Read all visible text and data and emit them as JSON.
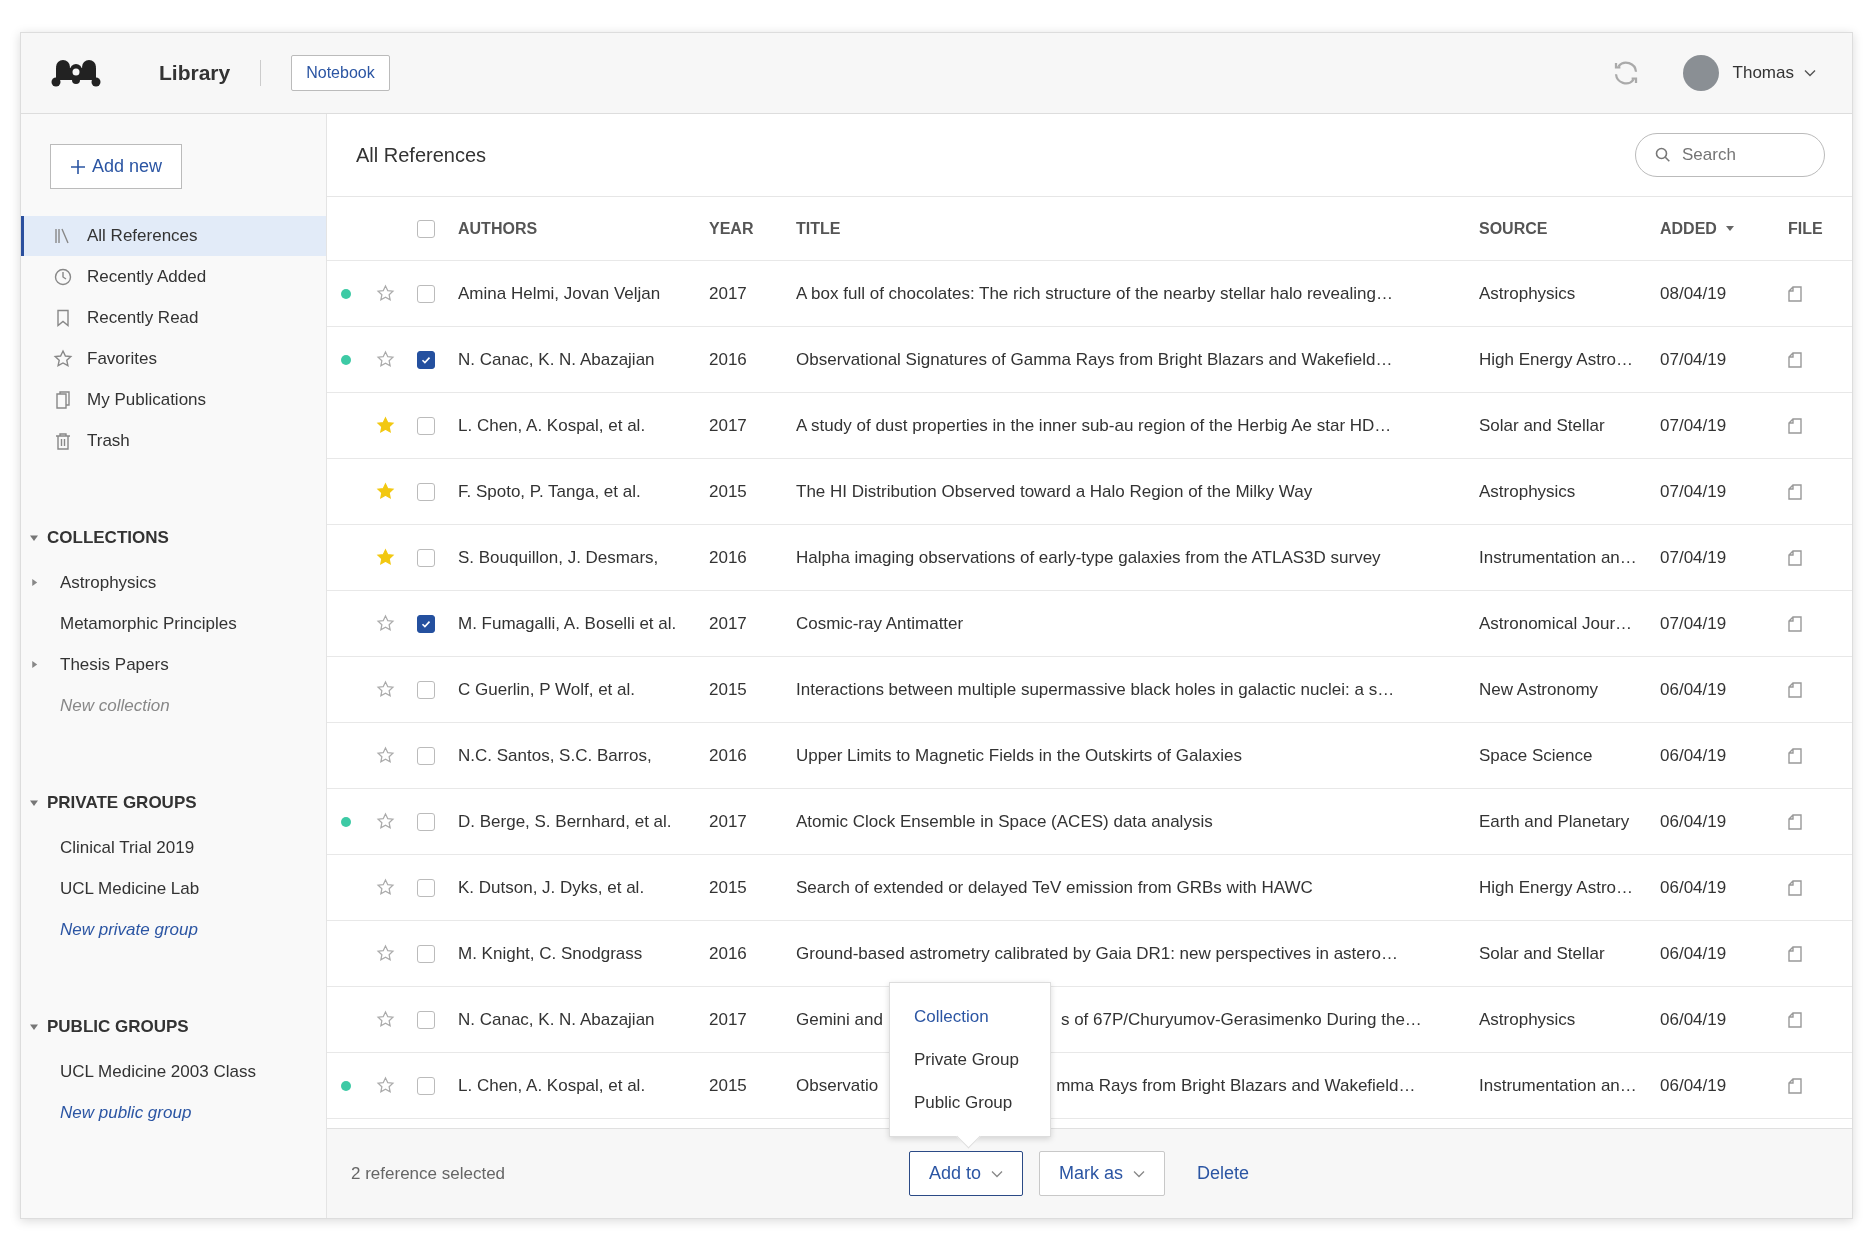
{
  "app": {
    "section": "Library",
    "notebook_button": "Notebook",
    "user": "Thomas"
  },
  "sidebar": {
    "add_button": "Add new",
    "nav": [
      {
        "label": "All References",
        "selected": true
      },
      {
        "label": "Recently Added",
        "selected": false
      },
      {
        "label": "Recently Read",
        "selected": false
      },
      {
        "label": "Favorites",
        "selected": false
      },
      {
        "label": "My Publications",
        "selected": false
      },
      {
        "label": "Trash",
        "selected": false
      }
    ],
    "sections": [
      {
        "title": "COLLECTIONS",
        "expanded": true,
        "items": [
          {
            "label": "Astrophysics",
            "kind": "folder",
            "expandable": true
          },
          {
            "label": "Metamorphic Principles",
            "kind": "folder",
            "expandable": false
          },
          {
            "label": "Thesis Papers",
            "kind": "folder",
            "expandable": true
          },
          {
            "label": "New collection",
            "kind": "placeholder",
            "expandable": false
          }
        ]
      },
      {
        "title": "PRIVATE GROUPS",
        "expanded": true,
        "items": [
          {
            "label": "Clinical Trial 2019",
            "kind": "folder",
            "expandable": false
          },
          {
            "label": "UCL Medicine Lab",
            "kind": "folder",
            "expandable": false
          },
          {
            "label": "New private group",
            "kind": "link",
            "expandable": false
          }
        ]
      },
      {
        "title": "PUBLIC GROUPS",
        "expanded": true,
        "items": [
          {
            "label": "UCL Medicine 2003 Class",
            "kind": "folder",
            "expandable": false
          },
          {
            "label": "New public group",
            "kind": "link",
            "expandable": false
          }
        ]
      }
    ]
  },
  "main": {
    "title": "All References",
    "search": {
      "placeholder": "Search"
    },
    "table": {
      "select_all_checked": false,
      "columns": [
        {
          "label": "AUTHORS",
          "sorted": false
        },
        {
          "label": "YEAR",
          "sorted": false
        },
        {
          "label": "TITLE",
          "sorted": false
        },
        {
          "label": "SOURCE",
          "sorted": false
        },
        {
          "label": "ADDED",
          "sorted": true
        },
        {
          "label": "FILE",
          "sorted": false
        }
      ],
      "rows": [
        {
          "unread": true,
          "starred": false,
          "checked": false,
          "authors": "Amina Helmi, Jovan Veljan",
          "year": "2017",
          "title": [
            "A box full of chocolates: The rich structure of the nearby stellar halo revealing…"
          ],
          "source": "Astrophysics",
          "added": "08/04/19"
        },
        {
          "unread": true,
          "starred": false,
          "checked": true,
          "authors": "N. Canac, K. N. Abazajian",
          "year": "2016",
          "title": [
            "Observational Signatures of Gamma Rays from Bright Blazars and Wakefield…"
          ],
          "source": "High Energy Astro…",
          "added": "07/04/19"
        },
        {
          "unread": false,
          "starred": true,
          "checked": false,
          "authors": "L. Chen, A. Kospal, et al.",
          "year": "2017",
          "title": [
            "A study of dust properties in the inner sub-au region of the Herbig Ae star HD…"
          ],
          "source": "Solar and Stellar",
          "added": "07/04/19"
        },
        {
          "unread": false,
          "starred": true,
          "checked": false,
          "authors": "F. Spoto, P. Tanga, et al.",
          "year": "2015",
          "title": [
            "The HI Distribution Observed toward a Halo Region of the Milky Way"
          ],
          "source": "Astrophysics",
          "added": "07/04/19"
        },
        {
          "unread": false,
          "starred": true,
          "checked": false,
          "authors": "S. Bouquillon, J. Desmars,",
          "year": "2016",
          "title": [
            "Halpha imaging observations of early-type galaxies from the ATLAS3D survey"
          ],
          "source": "Instrumentation an…",
          "added": "07/04/19"
        },
        {
          "unread": false,
          "starred": false,
          "checked": true,
          "authors": "M. Fumagalli, A. Boselli et al.",
          "year": "2017",
          "title": [
            "Cosmic-ray Antimatter"
          ],
          "source": "Astronomical Jour…",
          "added": "07/04/19"
        },
        {
          "unread": false,
          "starred": false,
          "checked": false,
          "authors": "C Guerlin, P Wolf, et al.",
          "year": "2015",
          "title": [
            "Interactions between multiple supermassive black holes in galactic nuclei: a s…"
          ],
          "source": "New Astronomy",
          "added": "06/04/19"
        },
        {
          "unread": false,
          "starred": false,
          "checked": false,
          "authors": "N.C. Santos, S.C. Barros,",
          "year": "2016",
          "title": [
            "Upper Limits to Magnetic Fields in the Outskirts of Galaxies"
          ],
          "source": "Space Science",
          "added": "06/04/19"
        },
        {
          "unread": true,
          "starred": false,
          "checked": false,
          "authors": "D. Berge, S. Bernhard, et al.",
          "year": "2017",
          "title": [
            "Atomic Clock Ensemble in Space (ACES) data analysis"
          ],
          "source": "Earth and Planetary",
          "added": "06/04/19"
        },
        {
          "unread": false,
          "starred": false,
          "checked": false,
          "authors": "K. Dutson, J. Dyks, et al.",
          "year": "2015",
          "title": [
            "Search of extended or delayed TeV emission from GRBs with HAWC"
          ],
          "source": "High Energy Astro…",
          "added": "06/04/19"
        },
        {
          "unread": false,
          "starred": false,
          "checked": false,
          "authors": "M. Knight, C. Snodgrass",
          "year": "2016",
          "title": [
            "Ground-based astrometry calibrated by Gaia DR1: new perspectives in astero…"
          ],
          "source": "Solar and Stellar",
          "added": "06/04/19"
        },
        {
          "unread": false,
          "starred": false,
          "checked": false,
          "authors": "N. Canac, K. N. Abazajian",
          "year": "2017",
          "title": [
            "Gemini and",
            "s of 67P/Churyumov-Gerasimenko During the…"
          ],
          "source": "Astrophysics",
          "added": "06/04/19"
        },
        {
          "unread": true,
          "starred": false,
          "checked": false,
          "authors": "L. Chen, A. Kospal, et al.",
          "year": "2015",
          "title": [
            "Observatio",
            "mma Rays from Bright Blazars and Wakefield…"
          ],
          "source": "Instrumentation an…",
          "added": "06/04/19"
        }
      ]
    }
  },
  "footer": {
    "selection": "2 reference selected",
    "add_button": "Add to",
    "mark_button": "Mark as",
    "delete_link": "Delete"
  },
  "add_menu": {
    "items": [
      {
        "label": "Collection",
        "selected": true
      },
      {
        "label": "Private Group",
        "selected": false
      },
      {
        "label": "Public Group",
        "selected": false
      }
    ]
  }
}
